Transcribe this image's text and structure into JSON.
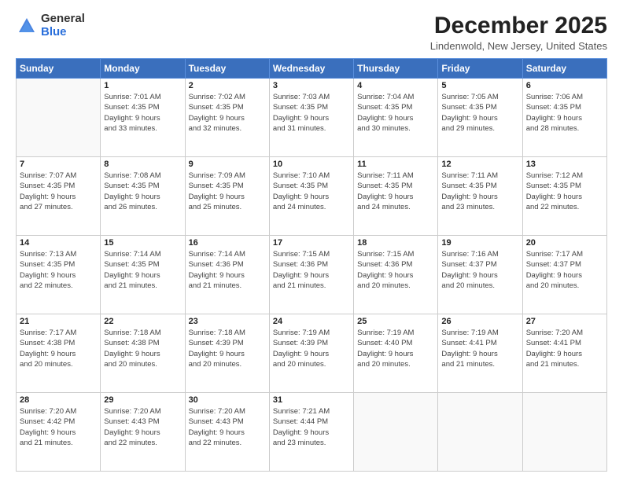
{
  "logo": {
    "general": "General",
    "blue": "Blue"
  },
  "title": {
    "month": "December 2025",
    "location": "Lindenwold, New Jersey, United States"
  },
  "headers": [
    "Sunday",
    "Monday",
    "Tuesday",
    "Wednesday",
    "Thursday",
    "Friday",
    "Saturday"
  ],
  "weeks": [
    [
      {
        "day": "",
        "info": ""
      },
      {
        "day": "1",
        "info": "Sunrise: 7:01 AM\nSunset: 4:35 PM\nDaylight: 9 hours\nand 33 minutes."
      },
      {
        "day": "2",
        "info": "Sunrise: 7:02 AM\nSunset: 4:35 PM\nDaylight: 9 hours\nand 32 minutes."
      },
      {
        "day": "3",
        "info": "Sunrise: 7:03 AM\nSunset: 4:35 PM\nDaylight: 9 hours\nand 31 minutes."
      },
      {
        "day": "4",
        "info": "Sunrise: 7:04 AM\nSunset: 4:35 PM\nDaylight: 9 hours\nand 30 minutes."
      },
      {
        "day": "5",
        "info": "Sunrise: 7:05 AM\nSunset: 4:35 PM\nDaylight: 9 hours\nand 29 minutes."
      },
      {
        "day": "6",
        "info": "Sunrise: 7:06 AM\nSunset: 4:35 PM\nDaylight: 9 hours\nand 28 minutes."
      }
    ],
    [
      {
        "day": "7",
        "info": "Sunrise: 7:07 AM\nSunset: 4:35 PM\nDaylight: 9 hours\nand 27 minutes."
      },
      {
        "day": "8",
        "info": "Sunrise: 7:08 AM\nSunset: 4:35 PM\nDaylight: 9 hours\nand 26 minutes."
      },
      {
        "day": "9",
        "info": "Sunrise: 7:09 AM\nSunset: 4:35 PM\nDaylight: 9 hours\nand 25 minutes."
      },
      {
        "day": "10",
        "info": "Sunrise: 7:10 AM\nSunset: 4:35 PM\nDaylight: 9 hours\nand 24 minutes."
      },
      {
        "day": "11",
        "info": "Sunrise: 7:11 AM\nSunset: 4:35 PM\nDaylight: 9 hours\nand 24 minutes."
      },
      {
        "day": "12",
        "info": "Sunrise: 7:11 AM\nSunset: 4:35 PM\nDaylight: 9 hours\nand 23 minutes."
      },
      {
        "day": "13",
        "info": "Sunrise: 7:12 AM\nSunset: 4:35 PM\nDaylight: 9 hours\nand 22 minutes."
      }
    ],
    [
      {
        "day": "14",
        "info": "Sunrise: 7:13 AM\nSunset: 4:35 PM\nDaylight: 9 hours\nand 22 minutes."
      },
      {
        "day": "15",
        "info": "Sunrise: 7:14 AM\nSunset: 4:35 PM\nDaylight: 9 hours\nand 21 minutes."
      },
      {
        "day": "16",
        "info": "Sunrise: 7:14 AM\nSunset: 4:36 PM\nDaylight: 9 hours\nand 21 minutes."
      },
      {
        "day": "17",
        "info": "Sunrise: 7:15 AM\nSunset: 4:36 PM\nDaylight: 9 hours\nand 21 minutes."
      },
      {
        "day": "18",
        "info": "Sunrise: 7:15 AM\nSunset: 4:36 PM\nDaylight: 9 hours\nand 20 minutes."
      },
      {
        "day": "19",
        "info": "Sunrise: 7:16 AM\nSunset: 4:37 PM\nDaylight: 9 hours\nand 20 minutes."
      },
      {
        "day": "20",
        "info": "Sunrise: 7:17 AM\nSunset: 4:37 PM\nDaylight: 9 hours\nand 20 minutes."
      }
    ],
    [
      {
        "day": "21",
        "info": "Sunrise: 7:17 AM\nSunset: 4:38 PM\nDaylight: 9 hours\nand 20 minutes."
      },
      {
        "day": "22",
        "info": "Sunrise: 7:18 AM\nSunset: 4:38 PM\nDaylight: 9 hours\nand 20 minutes."
      },
      {
        "day": "23",
        "info": "Sunrise: 7:18 AM\nSunset: 4:39 PM\nDaylight: 9 hours\nand 20 minutes."
      },
      {
        "day": "24",
        "info": "Sunrise: 7:19 AM\nSunset: 4:39 PM\nDaylight: 9 hours\nand 20 minutes."
      },
      {
        "day": "25",
        "info": "Sunrise: 7:19 AM\nSunset: 4:40 PM\nDaylight: 9 hours\nand 20 minutes."
      },
      {
        "day": "26",
        "info": "Sunrise: 7:19 AM\nSunset: 4:41 PM\nDaylight: 9 hours\nand 21 minutes."
      },
      {
        "day": "27",
        "info": "Sunrise: 7:20 AM\nSunset: 4:41 PM\nDaylight: 9 hours\nand 21 minutes."
      }
    ],
    [
      {
        "day": "28",
        "info": "Sunrise: 7:20 AM\nSunset: 4:42 PM\nDaylight: 9 hours\nand 21 minutes."
      },
      {
        "day": "29",
        "info": "Sunrise: 7:20 AM\nSunset: 4:43 PM\nDaylight: 9 hours\nand 22 minutes."
      },
      {
        "day": "30",
        "info": "Sunrise: 7:20 AM\nSunset: 4:43 PM\nDaylight: 9 hours\nand 22 minutes."
      },
      {
        "day": "31",
        "info": "Sunrise: 7:21 AM\nSunset: 4:44 PM\nDaylight: 9 hours\nand 23 minutes."
      },
      {
        "day": "",
        "info": ""
      },
      {
        "day": "",
        "info": ""
      },
      {
        "day": "",
        "info": ""
      }
    ]
  ]
}
